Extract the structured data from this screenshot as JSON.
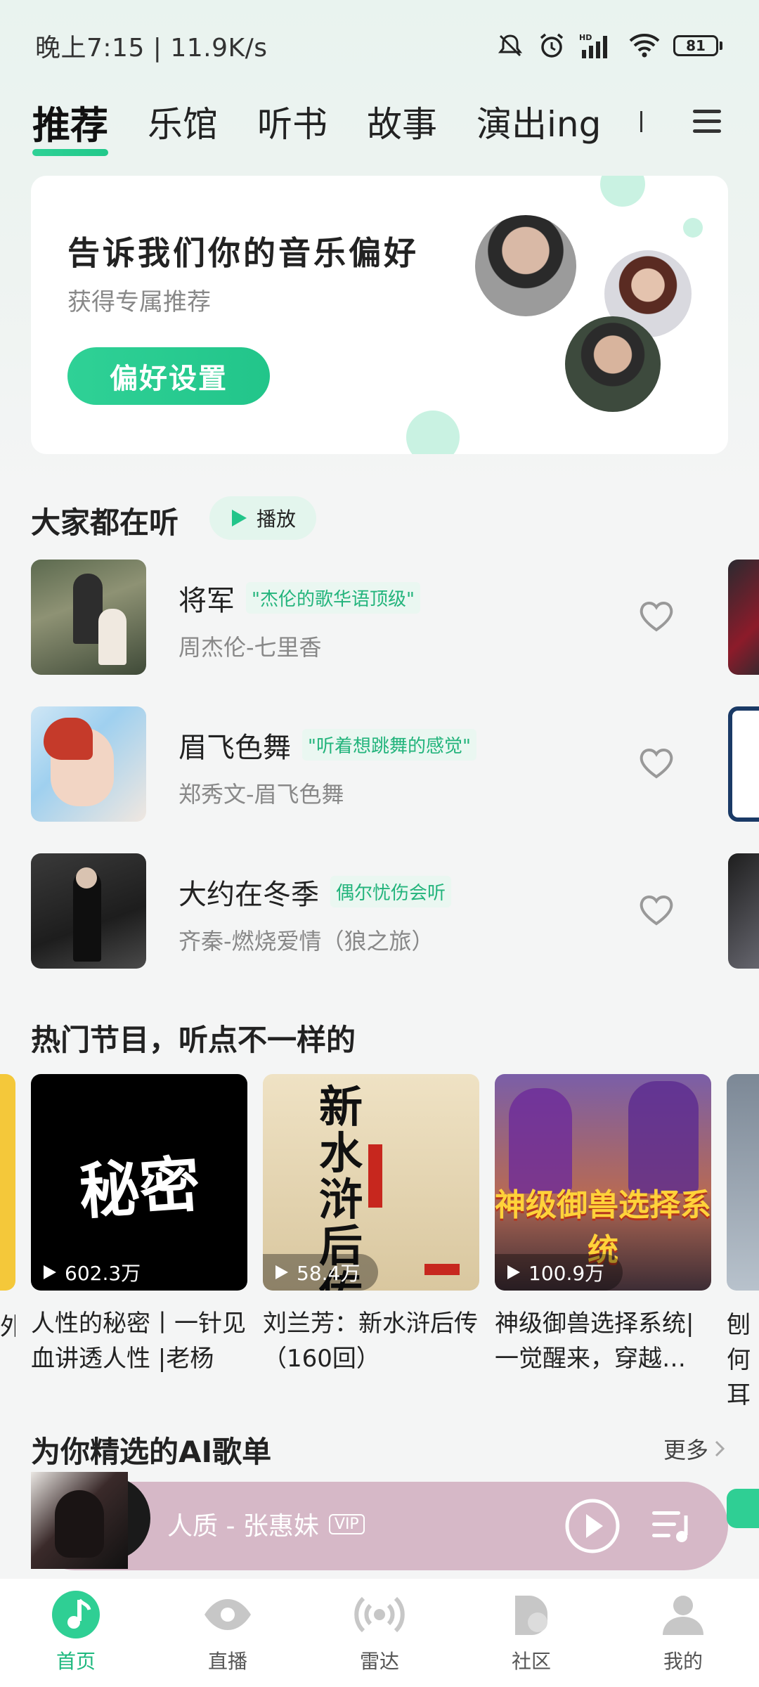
{
  "status_bar": {
    "time": "晚上7:15 | 11.9K/s",
    "battery": "81"
  },
  "top_tabs": [
    {
      "label": "推荐",
      "active": true
    },
    {
      "label": "乐馆",
      "active": false
    },
    {
      "label": "听书",
      "active": false
    },
    {
      "label": "故事",
      "active": false
    },
    {
      "label": "演出ing",
      "active": false
    }
  ],
  "preference_card": {
    "title": "告诉我们你的音乐偏好",
    "subtitle": "获得专属推荐",
    "button": "偏好设置"
  },
  "everyone_listening": {
    "title": "大家都在听",
    "play_label": "播放",
    "songs": [
      {
        "title": "将军",
        "tag": "\"杰伦的歌华语顶级\"",
        "artist": "周杰伦-七里香"
      },
      {
        "title": "眉飞色舞",
        "tag": "\"听着想跳舞的感觉\"",
        "artist": "郑秀文-眉飞色舞"
      },
      {
        "title": "大约在冬季",
        "tag": "偶尔忧伤会听",
        "artist": "齐秦-燃烧爱情（狼之旅）"
      }
    ]
  },
  "hot_programs": {
    "title": "热门节目，听点不一样的",
    "items": [
      {
        "plays": "602.3万",
        "title": "人性的秘密丨一针见血讲透人性 |老杨",
        "cover_text": "秘密"
      },
      {
        "plays": "58.4万",
        "title": "刘兰芳：新水浒后传（160回）",
        "cover_text": "新水浒后传"
      },
      {
        "plays": "100.9万",
        "title": "神级御兽选择系统|一觉醒来，穿越…",
        "cover_text": "神级御兽选择系统"
      }
    ],
    "peek_left": "外",
    "peek_right": "刨 何耳"
  },
  "ai_playlist": {
    "title": "为你精选的AI歌单",
    "more": "更多"
  },
  "mini_player": {
    "title": "人质 - 张惠妹",
    "vip": "VIP"
  },
  "bottom_nav": [
    {
      "label": "首页",
      "icon": "music-note-icon",
      "active": true
    },
    {
      "label": "直播",
      "icon": "eye-icon",
      "active": false
    },
    {
      "label": "雷达",
      "icon": "radar-icon",
      "active": false
    },
    {
      "label": "社区",
      "icon": "community-icon",
      "active": false
    },
    {
      "label": "我的",
      "icon": "profile-icon",
      "active": false
    }
  ],
  "colors": {
    "accent": "#22c58a",
    "mini_player_bg": "#d6b8c7"
  }
}
